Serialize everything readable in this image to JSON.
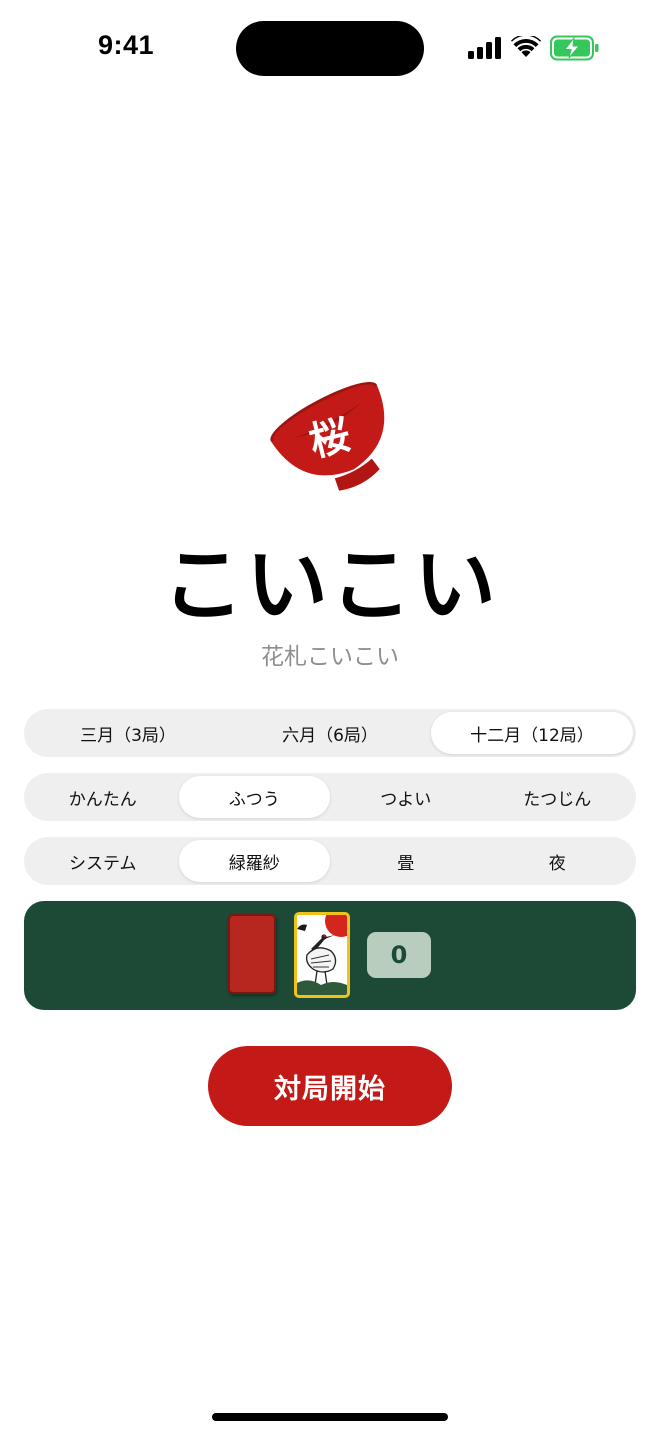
{
  "status_bar": {
    "time": "9:41",
    "icons": [
      "signal-icon",
      "wifi-icon",
      "battery-charging-icon"
    ]
  },
  "app": {
    "logo": "sakazuki-cup-logo",
    "logo_glyph": "桜",
    "title": "こいこい",
    "subtitle": "花札こいこい"
  },
  "rounds": {
    "options": [
      {
        "label": "三月（3局）"
      },
      {
        "label": "六月（6局）"
      },
      {
        "label": "十二月（12局）"
      }
    ],
    "selected": "十二月（12局）"
  },
  "difficulty": {
    "options": [
      {
        "label": "かんたん"
      },
      {
        "label": "ふつう"
      },
      {
        "label": "つよい"
      },
      {
        "label": "たつじん"
      }
    ],
    "selected": "ふつう"
  },
  "theme": {
    "options": [
      {
        "label": "システム"
      },
      {
        "label": "緑羅紗"
      },
      {
        "label": "畳"
      },
      {
        "label": "夜"
      }
    ],
    "selected": "緑羅紗"
  },
  "preview": {
    "card_back": "card-back-red",
    "card_face": "crane-and-sun-card",
    "score": "0"
  },
  "start_button": {
    "label": "対局開始"
  },
  "colors": {
    "accent_red": "#c41a17",
    "felt_green": "#1c4a36",
    "segment_bg": "#efefef",
    "subtitle_gray": "#8e8e93",
    "highlight_gold": "#f2c21a",
    "battery_green": "#34c759"
  }
}
